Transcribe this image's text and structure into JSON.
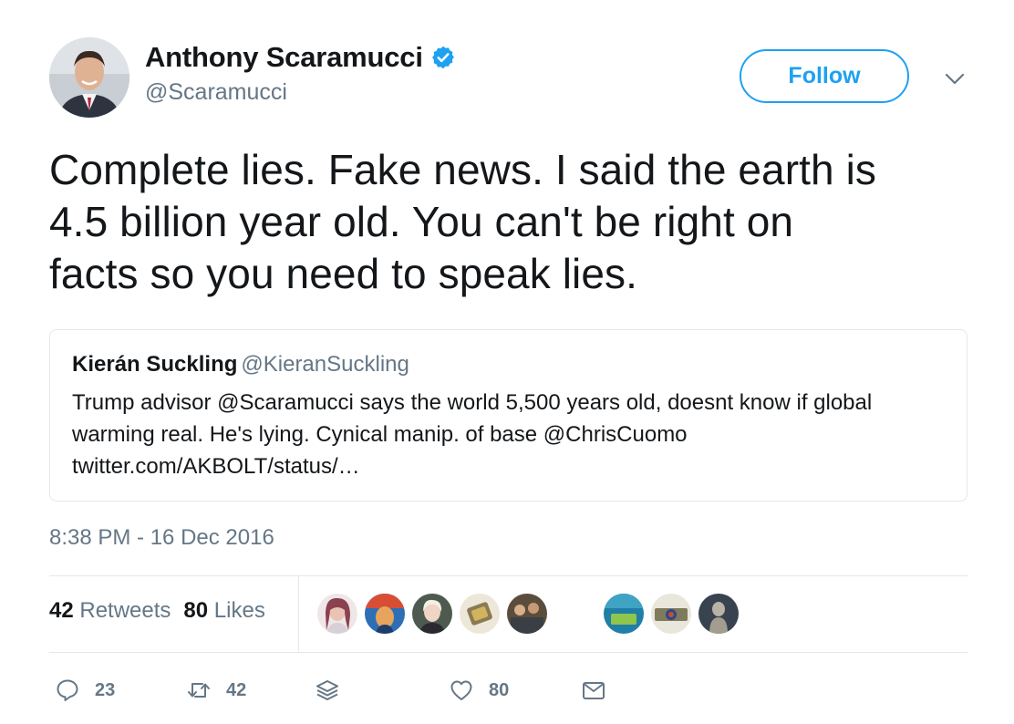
{
  "author": {
    "name": "Anthony Scaramucci",
    "handle": "@Scaramucci",
    "verified": true
  },
  "follow_button": {
    "label": "Follow"
  },
  "tweet": {
    "lines": [
      "Complete lies. Fake news. I said the earth is",
      "4.5 billion year old. You can't be right on",
      "facts so you need to speak lies."
    ]
  },
  "quoted_tweet": {
    "name": "Kierán Suckling",
    "handle": "@KieranSuckling",
    "lines": [
      "Trump advisor @Scaramucci says the world 5,500 years old, doesnt know if global",
      "warming real. He's lying. Cynical manip. of base @ChrisCuomo",
      "twitter.com/AKBOLT/status/…"
    ]
  },
  "timestamp": "8:38 PM - 16 Dec 2016",
  "stats": {
    "retweets_count": "42",
    "retweets_label": "Retweets",
    "likes_count": "80",
    "likes_label": "Likes"
  },
  "actions": {
    "reply_count": "23",
    "retweet_count": "42",
    "like_count": "80"
  },
  "icons": {
    "reply": "reply-icon",
    "retweet": "retweet-icon",
    "stack": "stack-icon",
    "like": "heart-icon",
    "message": "envelope-icon",
    "verified": "verified-badge-icon",
    "more": "chevron-down-icon"
  },
  "colors": {
    "accent": "#1da1f2",
    "text": "#14171a",
    "secondary": "#657786",
    "border": "#e1e8ed"
  }
}
